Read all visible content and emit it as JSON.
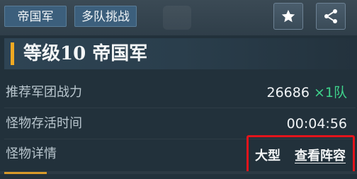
{
  "header": {
    "tags": [
      "帝国军",
      "多队挑战"
    ],
    "buttons": {
      "star_icon": "star-icon",
      "share_icon": "share-icon"
    }
  },
  "title": "等级10  帝国军",
  "rows": {
    "power": {
      "label": "推荐军团战力",
      "value": "26686",
      "multiplier": "×1队"
    },
    "time": {
      "label": "怪物存活时间",
      "value": "00:04:56"
    },
    "detail": {
      "label": "怪物详情",
      "size": "大型",
      "link": "查看阵容"
    }
  },
  "colors": {
    "accent": "#f0a922",
    "highlight": "#3fd48c",
    "annotation": "#e3141b"
  }
}
